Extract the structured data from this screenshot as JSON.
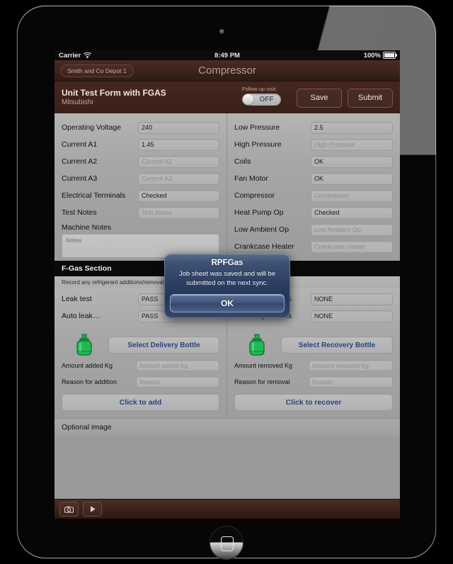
{
  "status_bar": {
    "carrier": "Carrier",
    "wifi_icon": "wifi-icon",
    "time": "8:49 PM",
    "battery_percent": "100%"
  },
  "nav_bar": {
    "back_label": "Smith and Co Depot 1",
    "title": "Compressor"
  },
  "form_header": {
    "title": "Unit Test Form with FGAS",
    "subtitle": "Mitsubishi",
    "toggle_label": "Follow up visit:",
    "toggle_state": "OFF",
    "save_label": "Save",
    "submit_label": "Submit"
  },
  "left_fields": [
    {
      "label": "Operating Voltage",
      "value": "240",
      "placeholder": "Operating Voltage",
      "filled": true
    },
    {
      "label": "Current A1",
      "value": "1.45",
      "placeholder": "Current A1",
      "filled": true
    },
    {
      "label": "Current A2",
      "value": "Current A2",
      "placeholder": "Current A2",
      "filled": false
    },
    {
      "label": "Current A3",
      "value": "Current A3",
      "placeholder": "Current A3",
      "filled": false
    },
    {
      "label": "Electrical Terminals",
      "value": "Checked",
      "placeholder": "Electrical Terminals",
      "filled": true
    },
    {
      "label": "Test Notes",
      "value": "Test Notes",
      "placeholder": "Test Notes",
      "filled": false
    }
  ],
  "machine_notes": {
    "label": "Machine Notes",
    "placeholder": "Notes"
  },
  "right_fields": [
    {
      "label": "Low Pressure",
      "value": "2.5",
      "placeholder": "Low Pressure",
      "filled": true
    },
    {
      "label": "High Pressure",
      "value": "High Pressure",
      "placeholder": "High Pressure",
      "filled": false
    },
    {
      "label": "Coils",
      "value": "OK",
      "placeholder": "Coils",
      "filled": true
    },
    {
      "label": "Fan Motor",
      "value": "OK",
      "placeholder": "Fan Motor",
      "filled": true
    },
    {
      "label": "Compressor",
      "value": "Compressor",
      "placeholder": "Compressor",
      "filled": false
    },
    {
      "label": "Heat Pump Op",
      "value": "Checked",
      "placeholder": "Heat Pump Op",
      "filled": true
    },
    {
      "label": "Low Ambient Op",
      "value": "Low Ambient Op",
      "placeholder": "Low Ambient Op",
      "filled": false
    },
    {
      "label": "Crankcase Heater",
      "value": "Crankcase Heater",
      "placeholder": "Crankcase Heater",
      "filled": false
    }
  ],
  "fgas": {
    "section_title": "F-Gas Section",
    "section_subtitle": "Record any refrigerant additions/removals and the result of any leak tests",
    "rows_left": [
      {
        "label": "Leak test",
        "value": "PASS",
        "filled": true
      },
      {
        "label": "Auto leak…",
        "value": "PASS",
        "filled": true
      }
    ],
    "rows_right": [
      {
        "label": "Follow up actions",
        "value": "NONE",
        "filled": true
      },
      {
        "label": "Follow up actions",
        "value": "NONE",
        "filled": true
      }
    ],
    "delivery": {
      "icon": "gas-cylinder-icon",
      "select_label": "Select Delivery Bottle",
      "amount_label": "Amount added Kg",
      "amount_placeholder": "Amount added Kg",
      "reason_label": "Reason for addition",
      "reason_placeholder": "Reason",
      "action_label": "Click to add"
    },
    "recovery": {
      "icon": "gas-cylinder-icon",
      "select_label": "Select Recovery Bottle",
      "amount_label": "Amount removed Kg",
      "amount_placeholder": "Amound removed Kg",
      "reason_label": "Reason for removal",
      "reason_placeholder": "Reason",
      "action_label": "Click to recover"
    },
    "optional_image_label": "Optional image"
  },
  "toolbar": {
    "camera_icon": "camera-icon",
    "play_icon": "play-icon"
  },
  "alert": {
    "title": "RPFGas",
    "message": "Job sheet was saved and will be submitted on the next sync.",
    "ok_label": "OK"
  },
  "colors": {
    "chrome_brown": "#3a211a",
    "accent_blue": "#29437e",
    "cylinder_green": "#1faa4b",
    "alert_blue": "#2c3e63"
  }
}
